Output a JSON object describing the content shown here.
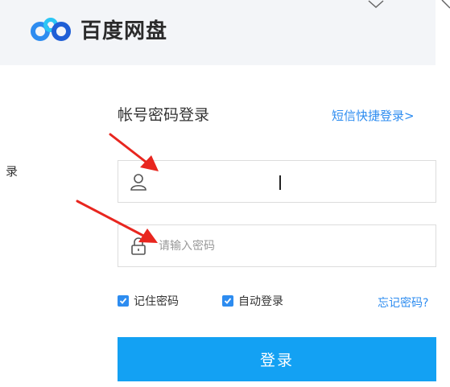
{
  "app": {
    "name": "百度网盘"
  },
  "side_text": "录",
  "login": {
    "title": "帐号密码登录",
    "sms_link": "短信快捷登录>",
    "username": {
      "value": "",
      "placeholder": ""
    },
    "password": {
      "value": "",
      "placeholder": "请输入密码"
    },
    "remember_label": "记住密码",
    "remember_checked": true,
    "auto_login_label": "自动登录",
    "auto_login_checked": true,
    "forgot_label": "忘记密码?",
    "submit_label": "登录"
  },
  "colors": {
    "accent": "#2d8cf0",
    "button": "#13a1f3",
    "arrow": "#e8261f",
    "header_bg": "#f3f5f8"
  },
  "icons": {
    "logo": "baidu-cloud-logo-icon",
    "user": "user-icon",
    "lock": "lock-icon",
    "check": "checkmark-icon"
  }
}
